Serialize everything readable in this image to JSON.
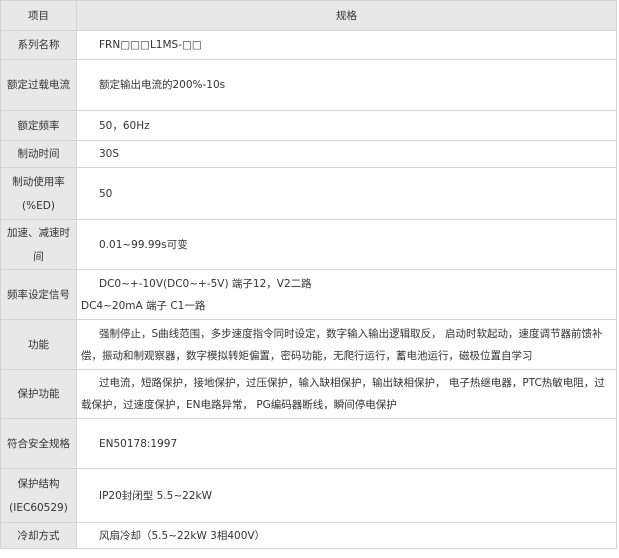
{
  "table": {
    "header": {
      "item": "项目",
      "spec": "规格"
    },
    "rows": [
      {
        "label": "系列名称",
        "value": "FRN□□□L1MS-□□"
      },
      {
        "label": "额定过载电流",
        "value": "额定输出电流的200%-10s"
      },
      {
        "label": "额定频率",
        "value": "50，60Hz"
      },
      {
        "label": "制动时间",
        "value": "30S"
      },
      {
        "label": "制动使用率(%ED)",
        "value": "50"
      },
      {
        "label": "加速、减速时间",
        "value": "0.01~99.99s可变"
      },
      {
        "label": "频率设定信号",
        "value_line1": "DC0~+-10V(DC0~+-5V) 端子12，V2二路",
        "value_line2": "DC4~20mA 端子 C1一路"
      },
      {
        "label": "功能",
        "value": "强制停止，S曲线范围，多步速度指令同时设定，数字输入输出逻辑取反， 启动时软起动，速度调节器前馈补偿，振动和制观察器，数字模拟转矩偏置，密码功能，无爬行运行，蓄电池运行，磁极位置自学习"
      },
      {
        "label": "保护功能",
        "value": "过电流，短路保护，接地保护，过压保护，输入缺相保护，输出缺相保护， 电子热继电器，PTC热敏电阻，过载保护，过速度保护，EN电路异常， PG编码器断线，瞬间停电保护"
      },
      {
        "label": "符合安全规格",
        "value": "EN50178:1997"
      },
      {
        "label": "保护结构(IEC60529)",
        "value": "IP20封闭型 5.5~22kW"
      },
      {
        "label": "冷却方式",
        "value": "风扇冷却（5.5~22kW 3相400V）"
      }
    ]
  }
}
